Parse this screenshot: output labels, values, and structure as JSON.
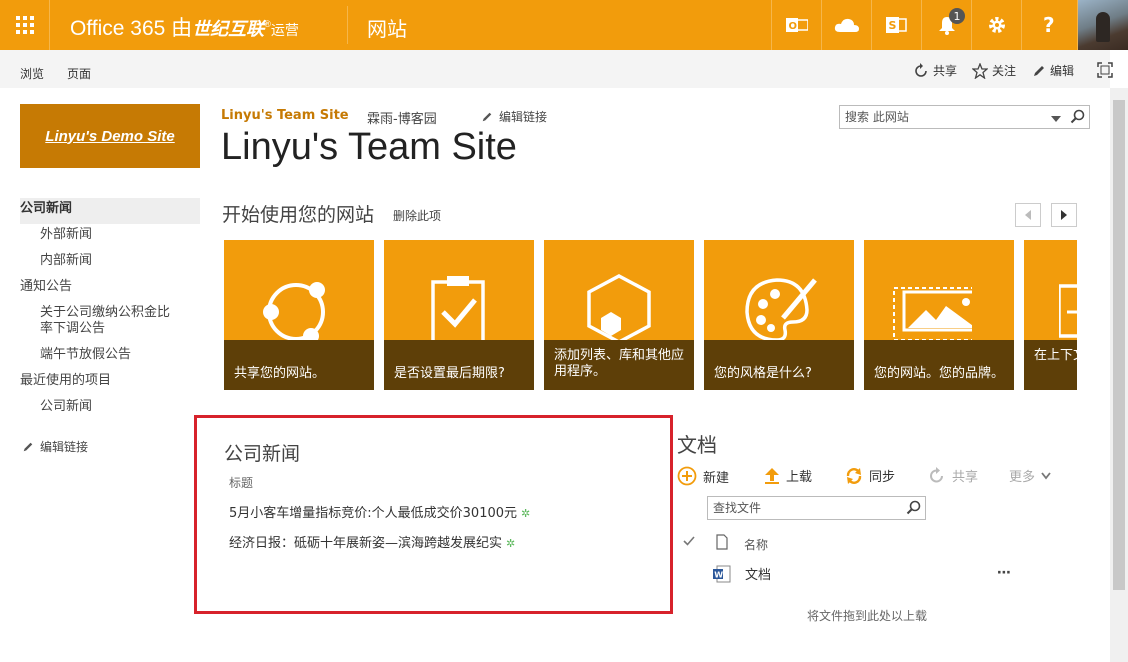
{
  "suite_bar": {
    "brand_prefix": "Office 365 由",
    "brand_operator": "世纪互联",
    "brand_suffix": "运营",
    "app_name": "网站",
    "notification_count": "1",
    "icons": [
      "waffle-icon",
      "outlook-icon",
      "onedrive-icon",
      "sway-icon",
      "bell-icon",
      "gear-icon",
      "help-icon"
    ]
  },
  "ribbon": {
    "tabs": [
      "浏览",
      "页面"
    ],
    "share": "共享",
    "follow": "关注",
    "edit": "编辑"
  },
  "site": {
    "logo_text": "Linyu's Demo Site",
    "breadcrumb": [
      "Linyu's Team Site",
      "霖雨-博客园"
    ],
    "edit_links": "编辑链接",
    "title": "Linyu's Team Site",
    "search_placeholder": "搜索 此网站"
  },
  "quick_launch": {
    "items": [
      {
        "label": "公司新闻",
        "level": 0,
        "selected": true
      },
      {
        "label": "外部新闻",
        "level": 1
      },
      {
        "label": "内部新闻",
        "level": 1
      },
      {
        "label": "通知公告",
        "level": 0
      },
      {
        "label": "关于公司缴纳公积金比率下调公告",
        "level": 1
      },
      {
        "label": "端午节放假公告",
        "level": 1
      },
      {
        "label": "最近使用的项目",
        "level": 0
      },
      {
        "label": "公司新闻",
        "level": 1
      }
    ],
    "edit_links": "编辑链接"
  },
  "getting_started": {
    "title": "开始使用您的网站",
    "remove": "删除此项",
    "tiles": [
      "共享您的网站。",
      "是否设置最后期限?",
      "添加列表、库和其他应用程序。",
      "您的风格是什么?",
      "您的网站。您的品牌。",
      "在上下文中工作。"
    ]
  },
  "news": {
    "title": "公司新闻",
    "column": "标题",
    "items": [
      "5月小客车增量指标竞价:个人最低成交价30100元",
      "经济日报：砥砺十年展新姿—滨海跨越发展纪实"
    ]
  },
  "documents": {
    "title": "文档",
    "actions": {
      "new": "新建",
      "upload": "上载",
      "sync": "同步",
      "share": "共享",
      "more": "更多"
    },
    "search_placeholder": "查找文件",
    "column_name": "名称",
    "files": [
      {
        "name": "文档"
      }
    ],
    "drop_hint": "将文件拖到此处以上载"
  },
  "colors": {
    "accent": "#f29c0c",
    "accent_dark": "#5e3f08",
    "logo_bg": "#c67a04",
    "highlight": "#d7222b"
  }
}
